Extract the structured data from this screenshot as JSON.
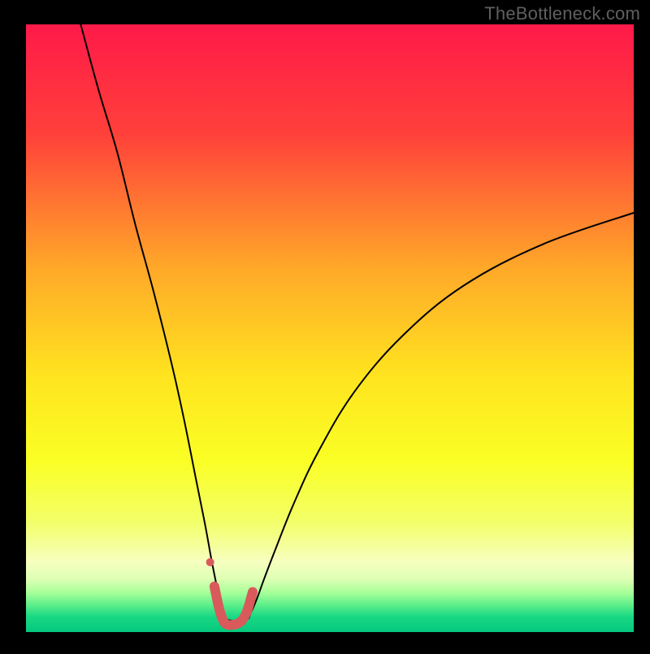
{
  "watermark": "TheBottleneck.com",
  "chart_data": {
    "type": "line",
    "title": "",
    "xlabel": "",
    "ylabel": "",
    "xlim": [
      0,
      100
    ],
    "ylim": [
      0,
      100
    ],
    "gradient_stops": [
      {
        "offset": 0.0,
        "color": "#ff1a49"
      },
      {
        "offset": 0.18,
        "color": "#ff403a"
      },
      {
        "offset": 0.4,
        "color": "#ffa829"
      },
      {
        "offset": 0.58,
        "color": "#ffe41f"
      },
      {
        "offset": 0.72,
        "color": "#faff25"
      },
      {
        "offset": 0.82,
        "color": "#f3ff6a"
      },
      {
        "offset": 0.885,
        "color": "#f6ffc0"
      },
      {
        "offset": 0.912,
        "color": "#dfffb4"
      },
      {
        "offset": 0.935,
        "color": "#a8ff9a"
      },
      {
        "offset": 0.955,
        "color": "#5fef8a"
      },
      {
        "offset": 0.975,
        "color": "#18d884"
      },
      {
        "offset": 1.0,
        "color": "#05c87e"
      }
    ],
    "series": [
      {
        "name": "bottleneck-curve",
        "stroke": "#000000",
        "stroke_width": 2,
        "x": [
          9.0,
          12,
          15,
          18,
          21,
          24,
          26,
          28,
          29.5,
          30.5,
          31.3,
          32.0,
          32.6,
          33.2,
          36.2,
          37.0,
          38.0,
          39.2,
          41.0,
          44.0,
          48.0,
          54.0,
          62.0,
          72.0,
          85.0,
          100.0
        ],
        "y": [
          100,
          89,
          79,
          67,
          56,
          44,
          35,
          25,
          17.5,
          12.0,
          8.0,
          5.0,
          3.0,
          2.0,
          2.0,
          3.2,
          5.5,
          8.8,
          13.5,
          21.0,
          29.5,
          39.5,
          48.8,
          57.0,
          63.8,
          69.0
        ]
      },
      {
        "name": "optimal-marker",
        "stroke": "#d85a5a",
        "stroke_width": 12,
        "x": [
          31.0,
          31.8,
          32.5,
          33.2,
          34.0,
          34.8,
          35.6,
          36.4,
          37.3
        ],
        "y": [
          7.5,
          3.8,
          1.8,
          1.2,
          1.2,
          1.4,
          2.0,
          3.5,
          6.6
        ]
      }
    ],
    "extra_markers": [
      {
        "name": "optimal-dot",
        "x": 30.3,
        "y": 11.5,
        "r": 5,
        "fill": "#d85a5a"
      }
    ]
  }
}
